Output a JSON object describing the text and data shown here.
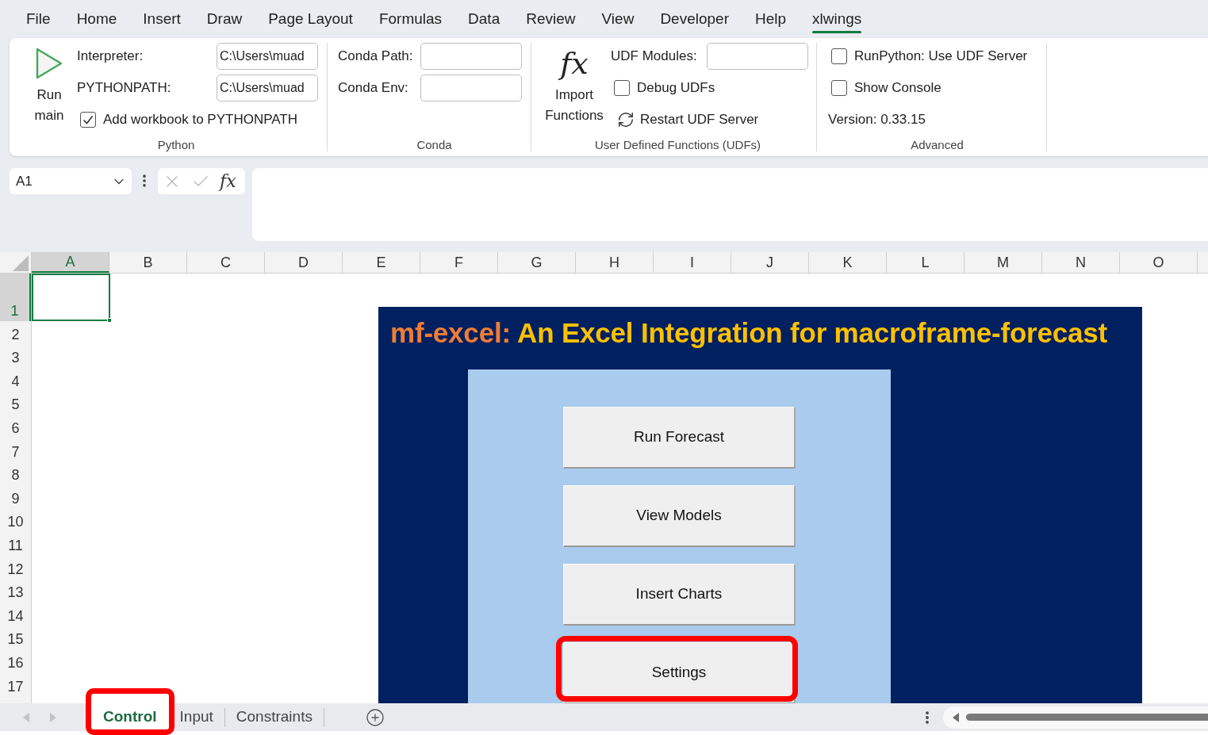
{
  "menu_tabs": [
    {
      "label": "File",
      "selected": false
    },
    {
      "label": "Home",
      "selected": false
    },
    {
      "label": "Insert",
      "selected": false
    },
    {
      "label": "Draw",
      "selected": false
    },
    {
      "label": "Page Layout",
      "selected": false
    },
    {
      "label": "Formulas",
      "selected": false
    },
    {
      "label": "Data",
      "selected": false
    },
    {
      "label": "Review",
      "selected": false
    },
    {
      "label": "View",
      "selected": false
    },
    {
      "label": "Developer",
      "selected": false
    },
    {
      "label": "Help",
      "selected": false
    },
    {
      "label": "xlwings",
      "selected": true
    }
  ],
  "ribbon_groups": [
    {
      "kind": "python",
      "label": "Python",
      "button": "Run main",
      "fields": [
        {
          "label": "Interpreter:",
          "value": "C:\\Users\\muad"
        },
        {
          "label": "PYTHONPATH:",
          "value": "C:\\Users\\muad"
        }
      ],
      "checkboxes": [
        {
          "label": "Add workbook to PYTHONPATH",
          "checked": true
        }
      ]
    },
    {
      "kind": "conda",
      "label": "Conda",
      "fields": [
        {
          "label": "Conda Path:"
        },
        {
          "label": "Conda Env:"
        }
      ]
    },
    {
      "kind": "udfs",
      "label": "User Defined Functions (UDFs)",
      "button": "Import Functions",
      "button_symbol": "fx",
      "fields": [
        {
          "label": "UDF Modules:"
        }
      ],
      "checkboxes": [
        {
          "label": "Debug UDFs",
          "checked": false
        }
      ],
      "action": "Restart UDF Server"
    },
    {
      "kind": "advanced",
      "label": "Advanced",
      "checkboxes": [
        {
          "label": "RunPython: Use UDF Server",
          "checked": false
        },
        {
          "label": "Show Console",
          "checked": false
        }
      ],
      "note": "Version: 0.33.15"
    }
  ],
  "formula_bar": {
    "name_box": "A1",
    "function_symbol": "fx"
  },
  "sheet": {
    "columns": [
      {
        "label": "A",
        "selected": true
      },
      {
        "label": "B",
        "selected": false
      },
      {
        "label": "C",
        "selected": false
      },
      {
        "label": "D",
        "selected": false
      },
      {
        "label": "E",
        "selected": false
      },
      {
        "label": "F",
        "selected": false
      },
      {
        "label": "G",
        "selected": false
      },
      {
        "label": "H",
        "selected": false
      },
      {
        "label": "I",
        "selected": false
      },
      {
        "label": "J",
        "selected": false
      },
      {
        "label": "K",
        "selected": false
      },
      {
        "label": "L",
        "selected": false
      },
      {
        "label": "M",
        "selected": false
      },
      {
        "label": "N",
        "selected": false
      },
      {
        "label": "O",
        "selected": false
      }
    ],
    "rows": [
      {
        "label": "1",
        "selected": true
      },
      {
        "label": "2",
        "selected": false
      },
      {
        "label": "3",
        "selected": false
      },
      {
        "label": "4",
        "selected": false
      },
      {
        "label": "5",
        "selected": false
      },
      {
        "label": "6",
        "selected": false
      },
      {
        "label": "7",
        "selected": false
      },
      {
        "label": "8",
        "selected": false
      },
      {
        "label": "9",
        "selected": false
      },
      {
        "label": "10",
        "selected": false
      },
      {
        "label": "11",
        "selected": false
      },
      {
        "label": "12",
        "selected": false
      },
      {
        "label": "13",
        "selected": false
      },
      {
        "label": "14",
        "selected": false
      },
      {
        "label": "15",
        "selected": false
      },
      {
        "label": "16",
        "selected": false
      },
      {
        "label": "17",
        "selected": false
      }
    ]
  },
  "dashboard": {
    "title_prefix": "mf-excel:",
    "title": "An Excel Integration for macroframe-forecast",
    "buttons": [
      {
        "label": "Run Forecast",
        "highlight": false
      },
      {
        "label": "View Models",
        "highlight": false
      },
      {
        "label": "Insert Charts",
        "highlight": false
      },
      {
        "label": "Settings",
        "highlight": true
      }
    ]
  },
  "sheet_tabs": [
    {
      "label": "Control",
      "selected": true,
      "highlight": true
    },
    {
      "label": "Input",
      "selected": false,
      "highlight": false
    },
    {
      "label": "Constraints",
      "selected": false,
      "highlight": false
    }
  ]
}
